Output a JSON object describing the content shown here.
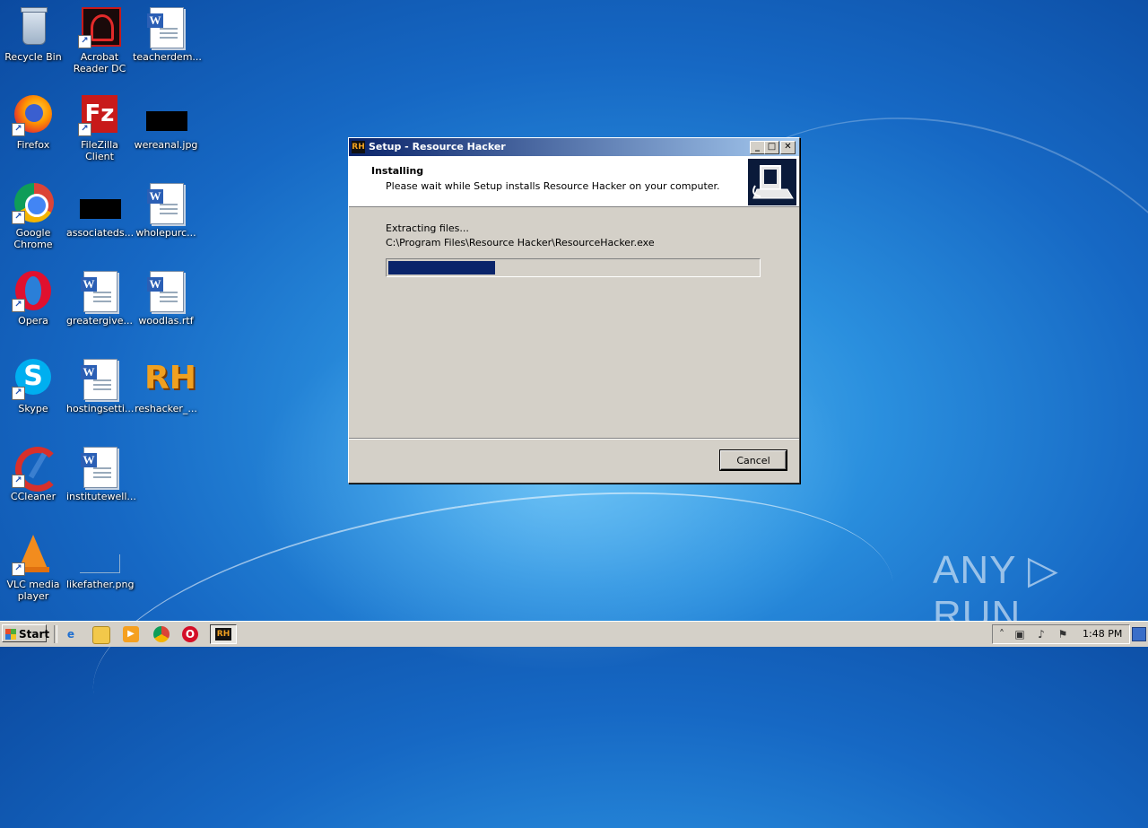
{
  "desktop": {
    "icons": [
      {
        "label": "Recycle Bin",
        "icon": "recycle-bin-icon"
      },
      {
        "label": "Acrobat Reader DC",
        "icon": "acrobat-icon"
      },
      {
        "label": "teacherdem...",
        "icon": "word-document-icon"
      },
      {
        "label": "Firefox",
        "icon": "firefox-icon"
      },
      {
        "label": "FileZilla Client",
        "icon": "filezilla-icon"
      },
      {
        "label": "wereanal.jpg",
        "icon": "image-file-icon"
      },
      {
        "label": "Google Chrome",
        "icon": "chrome-icon"
      },
      {
        "label": "associateds...",
        "icon": "image-file-icon"
      },
      {
        "label": "wholepurc...",
        "icon": "word-document-icon"
      },
      {
        "label": "Opera",
        "icon": "opera-icon"
      },
      {
        "label": "greatergive...",
        "icon": "word-document-icon"
      },
      {
        "label": "woodlas.rtf",
        "icon": "word-document-icon"
      },
      {
        "label": "Skype",
        "icon": "skype-icon"
      },
      {
        "label": "hostingsetti...",
        "icon": "word-document-icon"
      },
      {
        "label": "reshacker_...",
        "icon": "reshacker-icon"
      },
      {
        "label": "CCleaner",
        "icon": "ccleaner-icon"
      },
      {
        "label": "institutewell...",
        "icon": "word-document-icon"
      },
      {
        "label": "VLC media player",
        "icon": "vlc-icon"
      },
      {
        "label": "likefather.png",
        "icon": "image-file-icon"
      }
    ]
  },
  "dialog": {
    "title": "Setup - Resource Hacker",
    "app_icon_text": "RH",
    "heading": "Installing",
    "subheading": "Please wait while Setup installs Resource Hacker on your computer.",
    "status_line1": "Extracting files...",
    "status_line2": "C:\\Program Files\\Resource Hacker\\ResourceHacker.exe",
    "progress": 0.29,
    "cancel_label": "Cancel",
    "minimize_glyph": "_",
    "maximize_glyph": "□",
    "close_glyph": "✕"
  },
  "watermark": {
    "text": "ANY ▷ RUN"
  },
  "taskbar": {
    "start_label": "Start",
    "quick_launch": [
      "internet-explorer-icon",
      "explorer-folder-icon",
      "media-player-icon",
      "chrome-icon",
      "opera-icon"
    ],
    "active_task_text": "RH",
    "clock": "1:48 PM"
  },
  "colors": {
    "titlebar_start": "#0a246a",
    "titlebar_end": "#a6caf0",
    "progress_fill": "#0a246a",
    "dialog_face": "#d4d0c8"
  }
}
